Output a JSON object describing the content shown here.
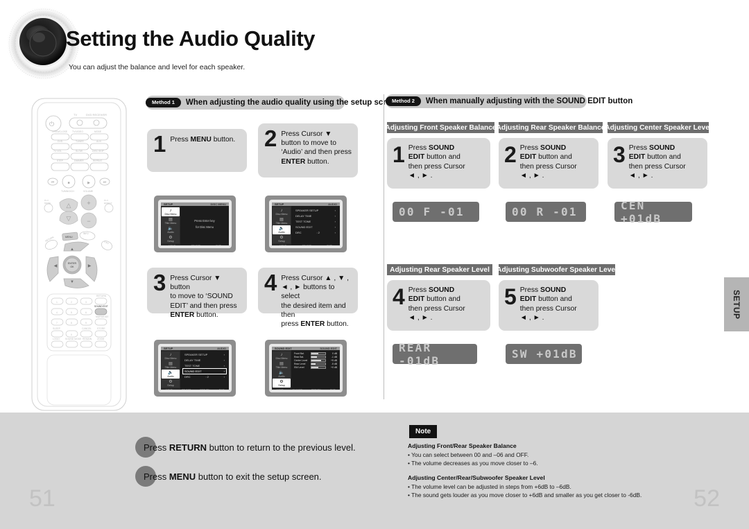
{
  "header": {
    "title": "Setting the Audio Quality",
    "subtitle": "You can adjust the balance and level for each speaker."
  },
  "method1": {
    "pill": "Method 1",
    "banner": "When adjusting the audio quality using the setup screen",
    "steps": [
      {
        "num": "1",
        "html": "Press <b>MENU</b> button."
      },
      {
        "num": "2",
        "html": "Press Cursor ▼<br>button to move to<br>‘Audio’ and then press<br><b>ENTER</b> button."
      },
      {
        "num": "3",
        "html": "Press Cursor ▼ button<br>to move to ‘SOUND<br>EDIT’ and then press<br><b>ENTER</b> button."
      },
      {
        "num": "4",
        "html": "Press Cursor ▲ , ▼ ,<br>◄ , ► buttons to select<br>the desired item and then<br>press <b>ENTER</b> button."
      }
    ],
    "screens": [
      {
        "title_left": "SETUP",
        "title_right": "DISC MENU",
        "side": [
          {
            "label": "Disc Menu",
            "icon": "♪",
            "selected": true
          },
          {
            "label": "Title Menu",
            "icon": "▤",
            "selected": false
          },
          {
            "label": "Audio",
            "icon": "◀)",
            "selected": false
          },
          {
            "label": "Setup",
            "icon": "⚙",
            "selected": false
          }
        ],
        "message_lines": [
          "Press Enter key",
          "for Disc Menu"
        ],
        "footer": [
          "MOVE",
          "SELECT",
          "EXIT"
        ]
      },
      {
        "title_left": "SETUP",
        "title_right": "AUDIO",
        "side": [
          {
            "label": "Disc Menu",
            "icon": "♪",
            "selected": false
          },
          {
            "label": "Title Menu",
            "icon": "▤",
            "selected": false
          },
          {
            "label": "Audio",
            "icon": "◀)",
            "selected": true
          },
          {
            "label": "Setup",
            "icon": "⚙",
            "selected": false
          }
        ],
        "rows": [
          {
            "label": "SPEAKER SETUP",
            "value": "",
            "highlight": false
          },
          {
            "label": "DELAY TIME",
            "value": "",
            "highlight": false
          },
          {
            "label": "TEST TONE",
            "value": "",
            "highlight": false
          },
          {
            "label": "SOUND EDIT",
            "value": "",
            "highlight": false
          },
          {
            "label": "DRC",
            "value": ": 2",
            "highlight": false
          }
        ],
        "footer": [
          "MOVE",
          "SELECT",
          "EXIT"
        ]
      },
      {
        "title_left": "SETUP",
        "title_right": "AUDIO",
        "side": [
          {
            "label": "Disc Menu",
            "icon": "♪",
            "selected": false
          },
          {
            "label": "Title Menu",
            "icon": "▤",
            "selected": false
          },
          {
            "label": "Audio",
            "icon": "◀)",
            "selected": true
          },
          {
            "label": "Setup",
            "icon": "⚙",
            "selected": false
          }
        ],
        "rows": [
          {
            "label": "SPEAKER SETUP",
            "value": "",
            "highlight": false
          },
          {
            "label": "DELAY TIME",
            "value": "",
            "highlight": false
          },
          {
            "label": "TEST TONE",
            "value": "",
            "highlight": false
          },
          {
            "label": "SOUND EDIT",
            "value": "",
            "highlight": true
          },
          {
            "label": "DRC",
            "value": ": 2",
            "highlight": false
          }
        ],
        "footer": [
          "MOVE",
          "SELECT",
          "RETURN",
          "EXIT"
        ]
      },
      {
        "title_left": "SOUND EDIT",
        "title_right": "SOUND EDIT",
        "side": [
          {
            "label": "Disc Menu",
            "icon": "♪",
            "selected": false
          },
          {
            "label": "Title Menu",
            "icon": "▤",
            "selected": false
          },
          {
            "label": "Audio",
            "icon": "◀)",
            "selected": false
          },
          {
            "label": "Setup",
            "icon": "⚙",
            "selected": true
          }
        ],
        "bars": [
          {
            "label": "Front Bal.",
            "value": "0 dB",
            "fill": 50,
            "highlight": true
          },
          {
            "label": "Rear Bal.",
            "value": "-1 dB",
            "fill": 42,
            "highlight": false
          },
          {
            "label": "Center Level",
            "value": "+5 dB",
            "fill": 70,
            "highlight": false
          },
          {
            "label": "Rear Level",
            "value": "-5 dB",
            "fill": 28,
            "highlight": false
          },
          {
            "label": "SW Level",
            "value": "+0 dB",
            "fill": 50,
            "highlight": false
          }
        ],
        "footer": [
          "MOVE",
          "CHANGE",
          "RETURN",
          "EXIT"
        ]
      }
    ]
  },
  "method2": {
    "pill": "Method 2",
    "banner": "When manually adjusting with the SOUND EDIT button",
    "sections": [
      {
        "label": "Adjusting Front Speaker Balance",
        "num": "1",
        "html": "Press <b>SOUND</b><br><b>EDIT</b> button and<br>then press Cursor<br>◄ , ► .",
        "display": "00 F -01"
      },
      {
        "label": "Adjusting Rear Speaker Balance",
        "num": "2",
        "html": "Press <b>SOUND</b><br><b>EDIT</b> button and<br>then press Cursor<br>◄ , ► .",
        "display": "00 R -01"
      },
      {
        "label": "Adjusting Center Speaker Level",
        "num": "3",
        "html": "Press <b>SOUND</b><br><b>EDIT</b> button and<br>then press Cursor<br>◄ , ► .",
        "display": "CEN +01dB"
      },
      {
        "label": "Adjusting Rear Speaker Level",
        "num": "4",
        "html": "Press <b>SOUND</b><br><b>EDIT</b> button and<br>then press Cursor<br>◄ , ► .",
        "display": "REAR -01dB"
      },
      {
        "label": "Adjusting Subwoofer Speaker Level",
        "num": "5",
        "html": "Press <b>SOUND</b><br><b>EDIT</b> button and<br>then press Cursor<br>◄ , ► .",
        "display": "SW  +01dB"
      }
    ]
  },
  "bottom": {
    "lines": [
      "Press <b>RETURN</b> button to return to the previous level.",
      "Press <b>MENU</b> button to exit the setup screen."
    ]
  },
  "note": {
    "badge": "Note",
    "heading1": "Adjusting Front/Rear Speaker Balance",
    "bullets1": [
      "• You can select between 00 and –06 and OFF.",
      "• The volume decreases as you move closer to –6."
    ],
    "heading2": "Adjusting Center/Rear/Subwoofer Speaker Level",
    "bullets2": [
      "• The volume level can be adjusted in steps from +6dB to –6dB.",
      "• The sound gets louder as you move closer to +6dB and smaller as you get closer to -6dB."
    ]
  },
  "side_tab": {
    "label": "SETUP"
  },
  "page_numbers": {
    "left": "51",
    "right": "52"
  },
  "remote": {
    "power": "⏻",
    "tv_label": "TV",
    "dvd_label": "DVD RECEIVER",
    "rows": [
      [
        "OPEN/CLOSE",
        "TV/VIDEO",
        "MODE"
      ],
      [
        "DVD",
        "TUNER",
        "AUX"
      ],
      [
        "TV VOL",
        "SLOW",
        "DISC SKIP"
      ],
      [
        "STEP",
        "DIMMER",
        "REPEAT"
      ]
    ],
    "transport": [
      "⏮",
      "■",
      "▶‖",
      "⏭"
    ],
    "tuning_label": "TUNING/CH",
    "volume_label": "VOLUME",
    "mode_label": "PL II MODE",
    "effect_label": "PL II EFFECT",
    "menu_label": "MENU",
    "info_label": "INFO",
    "return_label": "RETURN",
    "exit_label": "EXIT",
    "enter_label": "ENTER",
    "keypad": [
      "1",
      "2",
      "3",
      "4",
      "5",
      "6",
      "7",
      "8",
      "9",
      "0"
    ],
    "keypad_labels": [
      "RETURN",
      "SOUND EDIT",
      "MAP/MODE",
      "STORE",
      "SLEEP",
      "CANCEL",
      "LOGO",
      "SOUND MODE",
      "REMAIN"
    ],
    "sound_edit_key": "SOUND EDIT"
  }
}
